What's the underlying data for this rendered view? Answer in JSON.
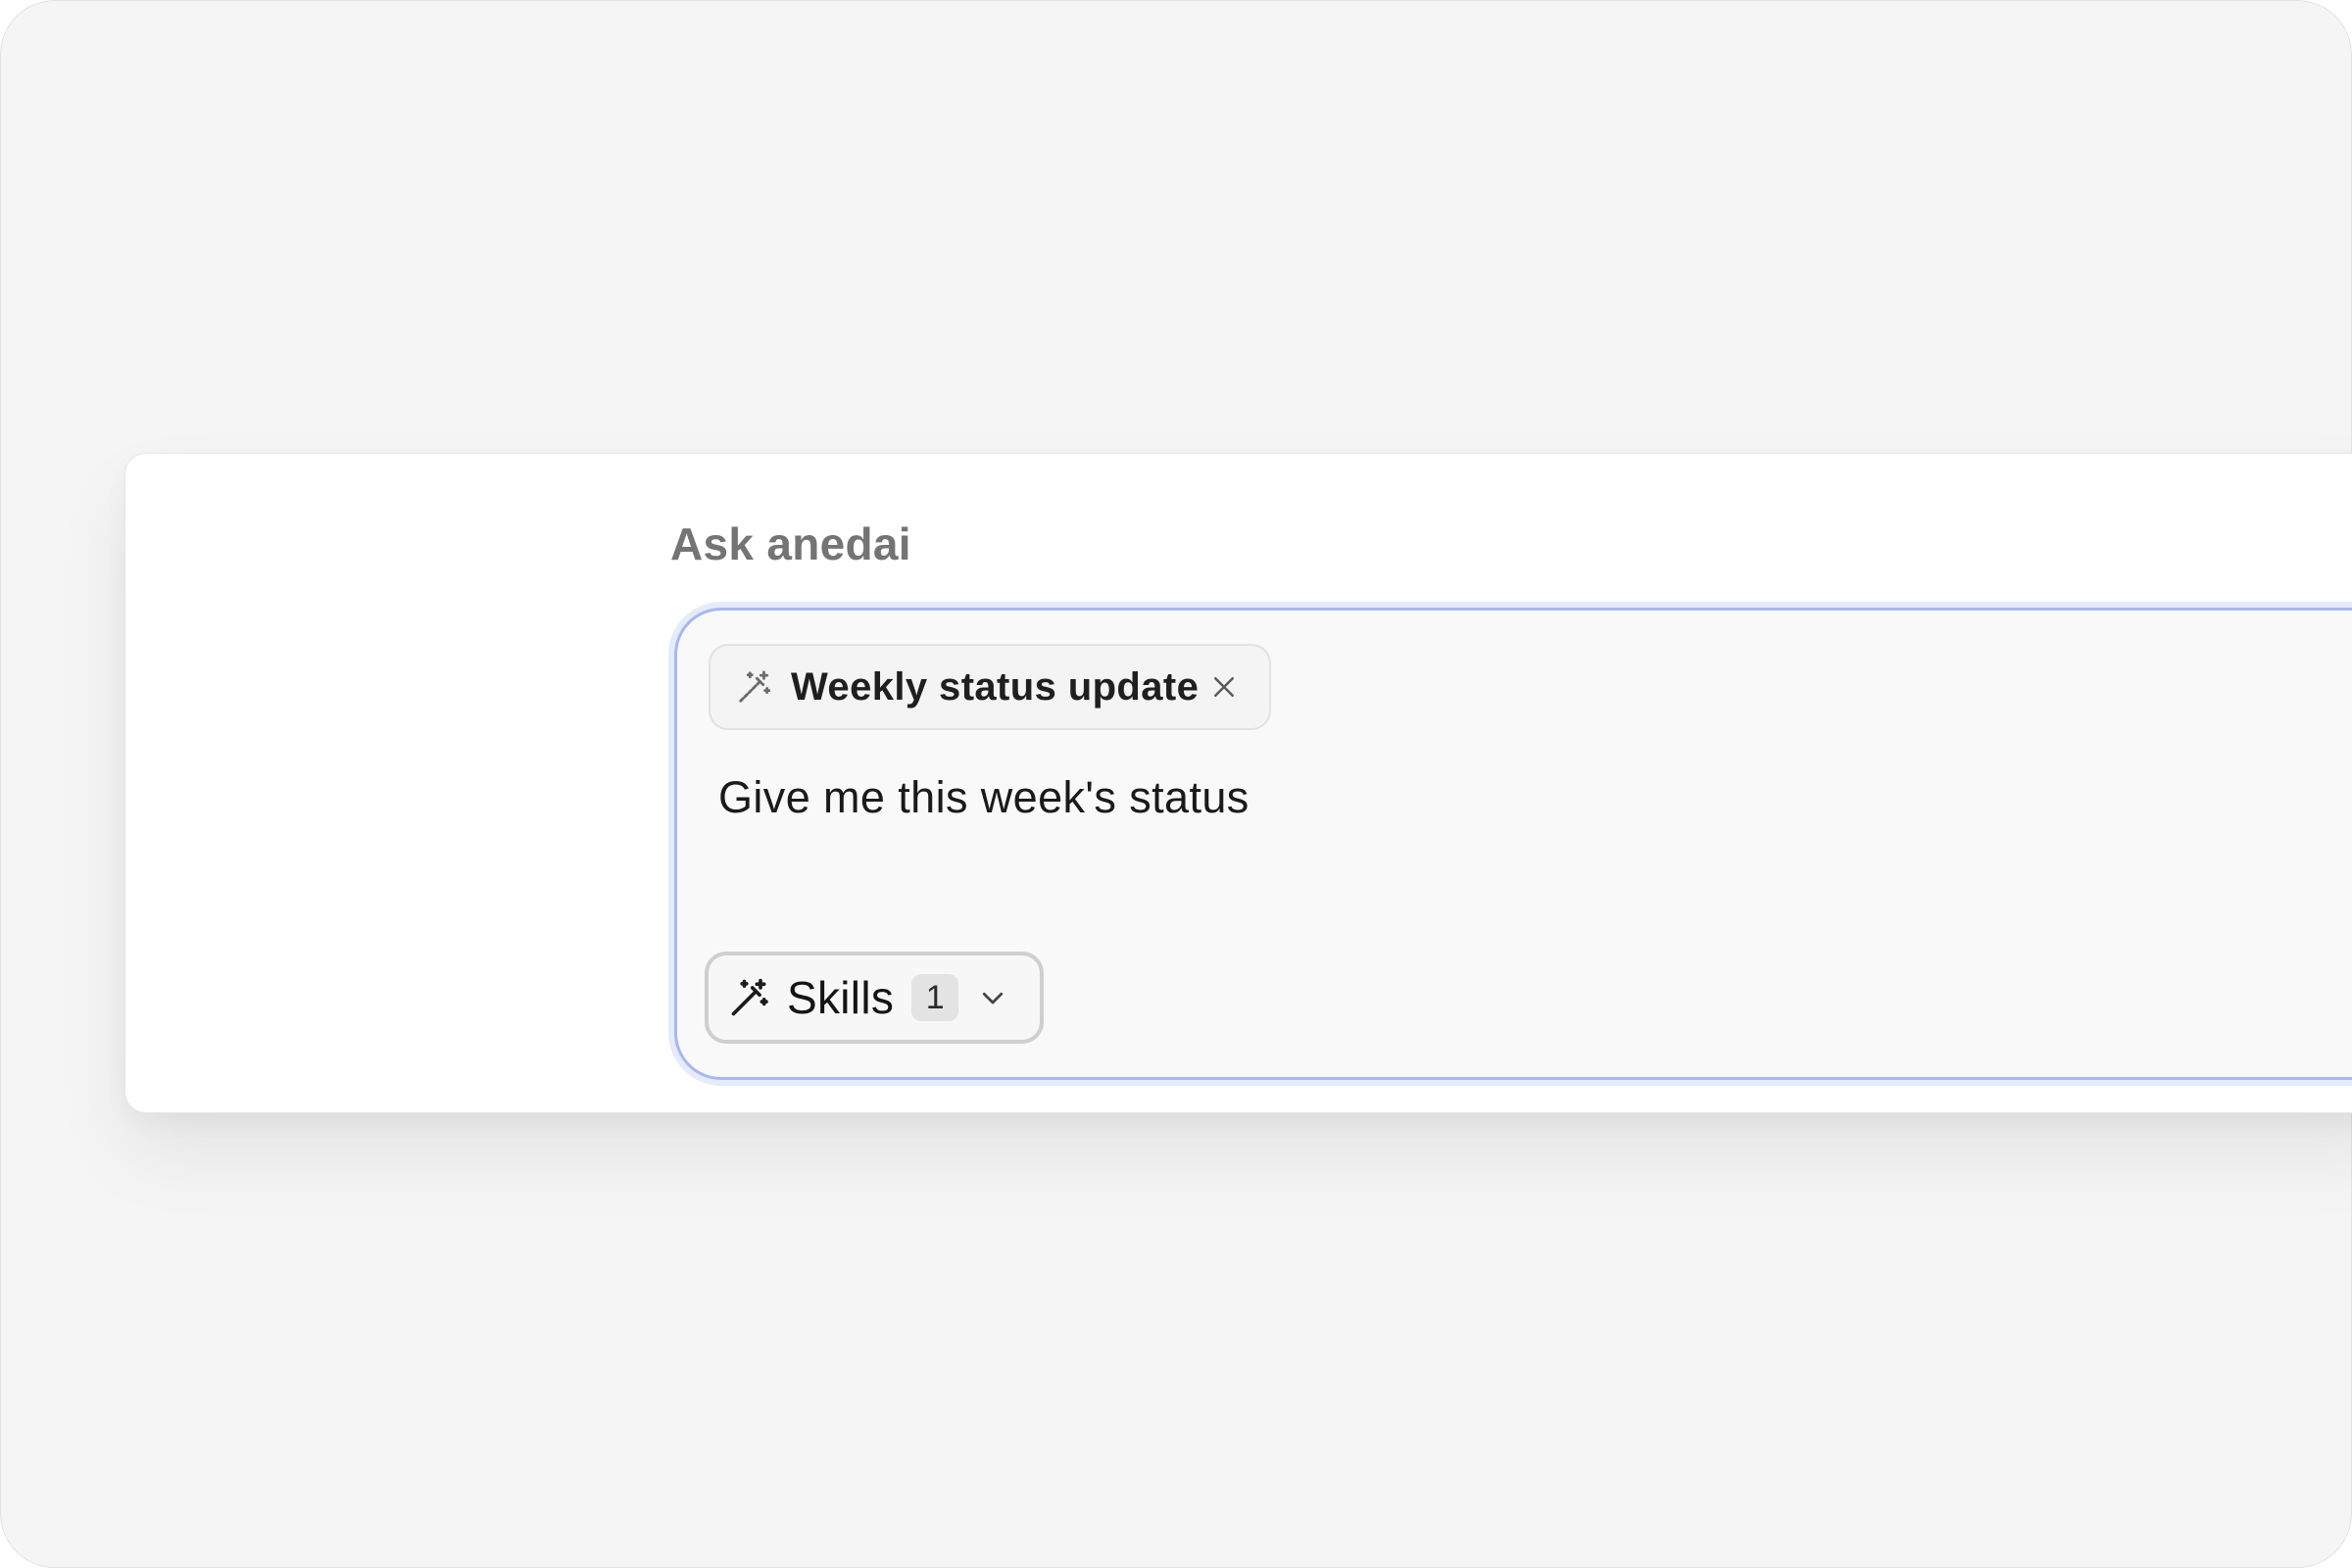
{
  "prompt_panel": {
    "heading": "Ask anedai"
  },
  "composer": {
    "skill_chip": {
      "label": "Weekly status update",
      "icon": "magic-wand-icon",
      "close_icon": "close-icon"
    },
    "message_text": "Give me this week's status",
    "skills_button": {
      "label": "Skills",
      "count": "1",
      "icon": "magic-wand-icon",
      "chevron_icon": "chevron-down-icon"
    }
  },
  "colors": {
    "focus_border": "#a6b8ef",
    "background": "#f5f5f5",
    "panel": "#ffffff"
  }
}
